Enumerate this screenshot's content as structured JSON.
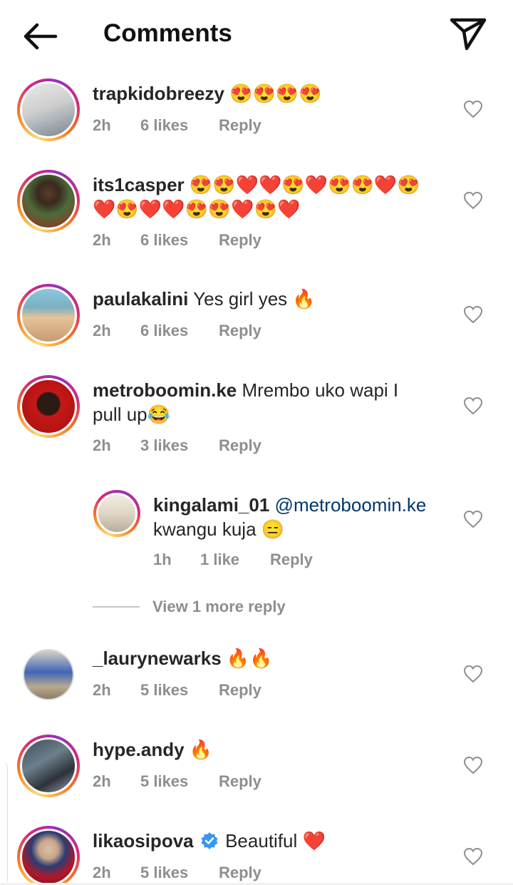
{
  "header": {
    "title": "Comments",
    "back_icon": "back-arrow-icon",
    "send_icon": "paper-plane-icon"
  },
  "comments": [
    {
      "username": "trapkidobreezy",
      "text": "😍😍😍😍",
      "time": "2h",
      "likes": "6 likes",
      "reply": "Reply"
    },
    {
      "username": "its1casper",
      "text": "😍😍❤️❤️😍❤️😍😍❤️😍",
      "text2": "❤️😍❤️❤️😍😍❤️😍❤️",
      "time": "2h",
      "likes": "6 likes",
      "reply": "Reply"
    },
    {
      "username": "paulakalini",
      "text": "Yes girl yes 🔥",
      "time": "2h",
      "likes": "6 likes",
      "reply": "Reply"
    },
    {
      "username": "metroboomin.ke",
      "text": "Mrembo uko wapi I",
      "text2": "pull up😂",
      "time": "2h",
      "likes": "3 likes",
      "reply": "Reply"
    },
    {
      "username": "kingalami_01",
      "mention": "@metroboomin.ke",
      "text2": "kwangu kuja 😑",
      "time": "1h",
      "likes": "1 like",
      "reply": "Reply"
    },
    {
      "username": "_laurynewarks",
      "text": "🔥🔥",
      "time": "2h",
      "likes": "5 likes",
      "reply": "Reply"
    },
    {
      "username": "hype.andy",
      "text": "🔥",
      "time": "2h",
      "likes": "5 likes",
      "reply": "Reply"
    },
    {
      "username": "likaosipova",
      "text": "Beautiful ❤️",
      "time": "2h",
      "likes": "5 likes",
      "reply": "Reply"
    }
  ],
  "view_more": "View 1 more reply",
  "colors": {
    "text": "#262626",
    "meta": "#8e8e8e",
    "mention": "#00376b",
    "verified": "#3897f0"
  }
}
